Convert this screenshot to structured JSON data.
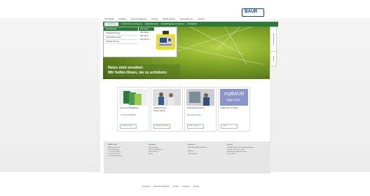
{
  "topnav": [
    "Über BAUR",
    "Produkte",
    "Service & Beratung",
    "Karriere",
    "BAUR weltweit",
    "Veranstaltungen",
    "Deutsch"
  ],
  "logo": {
    "text": "BAUR",
    "slogan": "Leading the Way"
  },
  "mainnav": [
    "Kabelbrüfung",
    "Kabelprüfung und Diagnose",
    "Kabelfehlerortung",
    "Isolieröltestgeräte und Systeme",
    "Produktfinder"
  ],
  "dropdown": {
    "col1": [
      "Kabelbrüfung",
      "Öl/Isolierölprüfung",
      "Verkaufsdemontanz",
      "Software ITS Lite"
    ],
    "col2": [
      "DTA 100 C",
      "DTA 100 E",
      "DTA 100 C",
      "DTA 100 C L"
    ]
  },
  "hero": {
    "line1": "Netze sind sensibel.",
    "line2": "Wir helfen Ihnen, sie zu schützen."
  },
  "sidetabs": [
    "Datenbank-Login",
    "Kontakt"
  ],
  "cards": [
    {
      "cap1": "Der neue Produktkatalog",
      "cap2": "",
      "sub": "– auf sich ein Einblick",
      "btn": "Produkt-Teaser"
    },
    {
      "cap1": "Schleifen für Ihre",
      "cap2": "Partner voll aus",
      "sub": "",
      "btn": "Kontakt mit BAUR"
    },
    {
      "cap1": "Professioneller Service",
      "cap2": "",
      "sub": "für unsere Kunden",
      "btn": "Mehr erfahren"
    },
    {
      "cap1": "Willkommen zu myBaur",
      "cap2": "",
      "sub": "",
      "btn": "Login"
    }
  ],
  "mybaur": {
    "title": "myBAUR",
    "subtitle": "login area"
  },
  "footer": [
    {
      "head": "BAUR GmbH",
      "lines": [
        "Raiffeisenstraße 8",
        "6832 Sulz/Austria",
        "T. +43 5522 4941-0",
        "F. +43 5522 4941-3",
        "E. headoffice@baur.at"
      ]
    },
    {
      "head": "Quicklinks",
      "lines": [
        "Presseberichte",
        "Weiterung Aufklärung",
        "Beta-Lieferung",
        "Presse"
      ]
    },
    {
      "head": "Newsletter",
      "lines": [
        "Anmeldung BAUR Newsletter",
        "Karriere",
        "Offene Stellen"
      ]
    },
    {
      "head": "Kontakt",
      "lines": [
        "Bei BAUR finden Sie die Ansprechpartner",
        "Vertrieb und Service sowie",
        "Kompetenten Ansprechpartner",
        "in Ihrer Nähe"
      ]
    }
  ],
  "bottomlinks": [
    "Impressum",
    "Datenschutzerklärung",
    "Kontakt",
    "Impressum",
    "Sitemap"
  ]
}
